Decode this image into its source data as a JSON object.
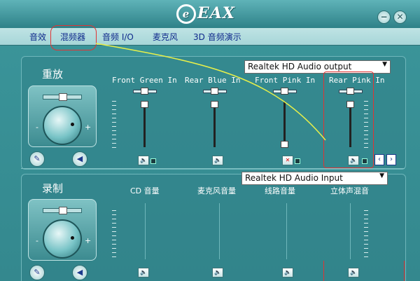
{
  "app": {
    "brand": "EAX",
    "brand_mark": "e"
  },
  "window": {
    "minimize_symbol": "−",
    "close_symbol": "✕"
  },
  "tabs": [
    {
      "label": "音效"
    },
    {
      "label": "混频器"
    },
    {
      "label": "音频 I/O"
    },
    {
      "label": "麦克风"
    },
    {
      "label": "3D 音频演示"
    }
  ],
  "playback": {
    "title": "重放",
    "device": "Realtek HD Audio output",
    "channels": [
      {
        "label": "Front Green In",
        "level": 0.72
      },
      {
        "label": "Rear Blue In",
        "level": 0.72
      },
      {
        "label": "Front Pink In",
        "level": 0.05,
        "muted": true
      },
      {
        "label": "Rear Pink In",
        "level": 0.72
      }
    ],
    "minus": "-",
    "plus": "+"
  },
  "recording": {
    "title": "录制",
    "device": "Realtek HD Audio Input",
    "channels": [
      {
        "label": "CD 音量"
      },
      {
        "label": "麦克风音量"
      },
      {
        "label": "线路音量"
      },
      {
        "label": "立体声混音"
      }
    ],
    "minus": "-",
    "plus": "+"
  },
  "icons": {
    "tool": "wrench-icon",
    "speaker": "speaker-icon",
    "prev": "‹",
    "next": "›"
  },
  "colors": {
    "highlight": "#e03434",
    "annotation_line": "#e8f04a",
    "tab_text": "#102a8c"
  }
}
